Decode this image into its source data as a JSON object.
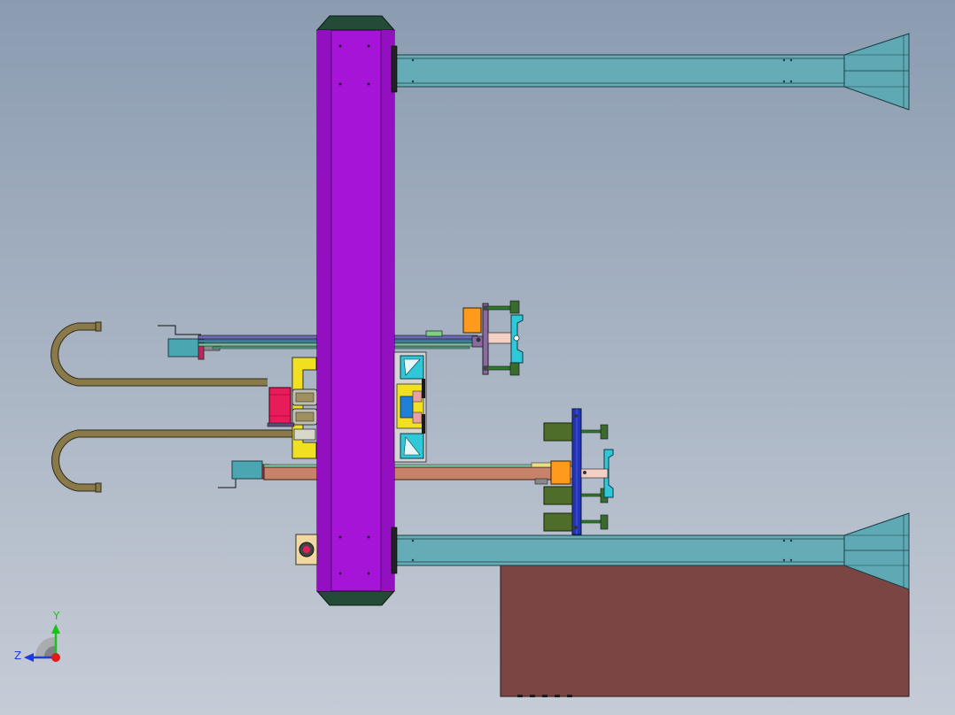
{
  "window": {
    "type": "cad-viewport",
    "background_top": "#8b9cb1",
    "background_bottom": "#c6ccd6"
  },
  "colors": {
    "main_column": "#a614d8",
    "column_cap": "#244a38",
    "rail": "#66acb6",
    "rail_end": "#5ea9b4",
    "base_block": "#7a4542",
    "hose": "#8a7a4a",
    "sliding_arm": "#c8826a",
    "orange_block": "#ff9a1c",
    "cyan_part": "#2ec8d8",
    "green_cylinder": "#4f6d2a",
    "blue_plate": "#2234b8",
    "yellow_frame": "#f0e020",
    "red_motor": "#e81c5a"
  },
  "axis_triad": {
    "y_label": "Y",
    "z_label": "Z",
    "y_color": "#19c419",
    "z_color": "#1a3ce0",
    "x_color": "#e01919"
  }
}
